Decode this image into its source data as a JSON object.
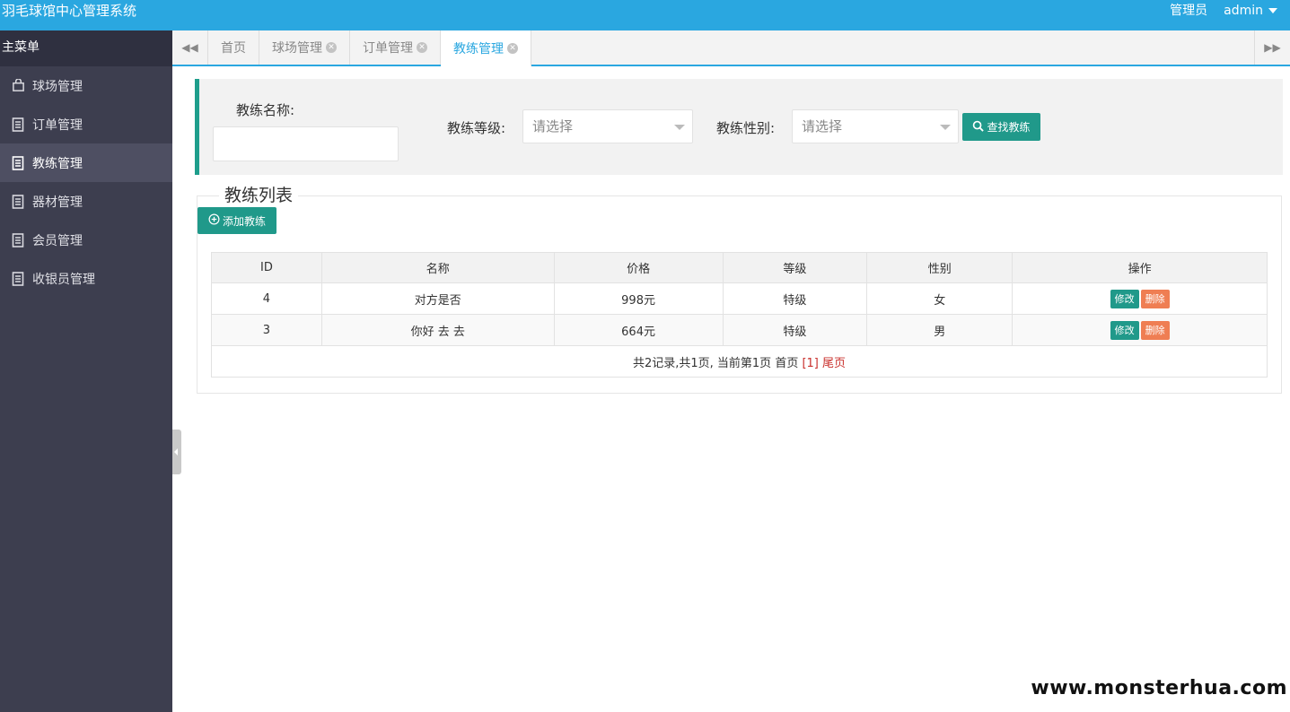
{
  "app": {
    "title": "羽毛球馆中心管理系统"
  },
  "header": {
    "role_label": "管理员",
    "username": "admin"
  },
  "sidebar": {
    "header": "主菜单",
    "items": [
      {
        "label": "球场管理",
        "icon": "bag-icon"
      },
      {
        "label": "订单管理",
        "icon": "document-icon"
      },
      {
        "label": "教练管理",
        "icon": "document-icon",
        "active": true
      },
      {
        "label": "器材管理",
        "icon": "document-icon"
      },
      {
        "label": "会员管理",
        "icon": "document-icon"
      },
      {
        "label": "收银员管理",
        "icon": "document-icon"
      }
    ]
  },
  "tabs": [
    {
      "label": "首页",
      "closable": false
    },
    {
      "label": "球场管理",
      "closable": true
    },
    {
      "label": "订单管理",
      "closable": true
    },
    {
      "label": "教练管理",
      "closable": true,
      "active": true
    }
  ],
  "search": {
    "name_label": "教练名称:",
    "name_value": "",
    "level_label": "教练等级:",
    "level_placeholder": "请选择",
    "gender_label": "教练性别:",
    "gender_placeholder": "请选择",
    "search_button": "查找教练"
  },
  "list": {
    "legend": "教练列表",
    "add_button": "添加教练",
    "columns": [
      "ID",
      "名称",
      "价格",
      "等级",
      "性别",
      "操作"
    ],
    "rows": [
      {
        "id": "4",
        "name": "对方是否",
        "price": "998元",
        "level": "特级",
        "gender": "女"
      },
      {
        "id": "3",
        "name": "你好 去 去",
        "price": "664元",
        "level": "特级",
        "gender": "男"
      }
    ],
    "edit_label": "修改",
    "delete_label": "删除",
    "pager": {
      "summary": "共2记录,共1页, 当前第1页",
      "first": "首页",
      "current": "[1]",
      "last": "尾页"
    }
  },
  "watermark": "www.monsterhua.com",
  "colors": {
    "topbar": "#2aa7e0",
    "sidebar": "#3d3e4f",
    "accent": "#20998a",
    "danger": "#ef7e53"
  }
}
